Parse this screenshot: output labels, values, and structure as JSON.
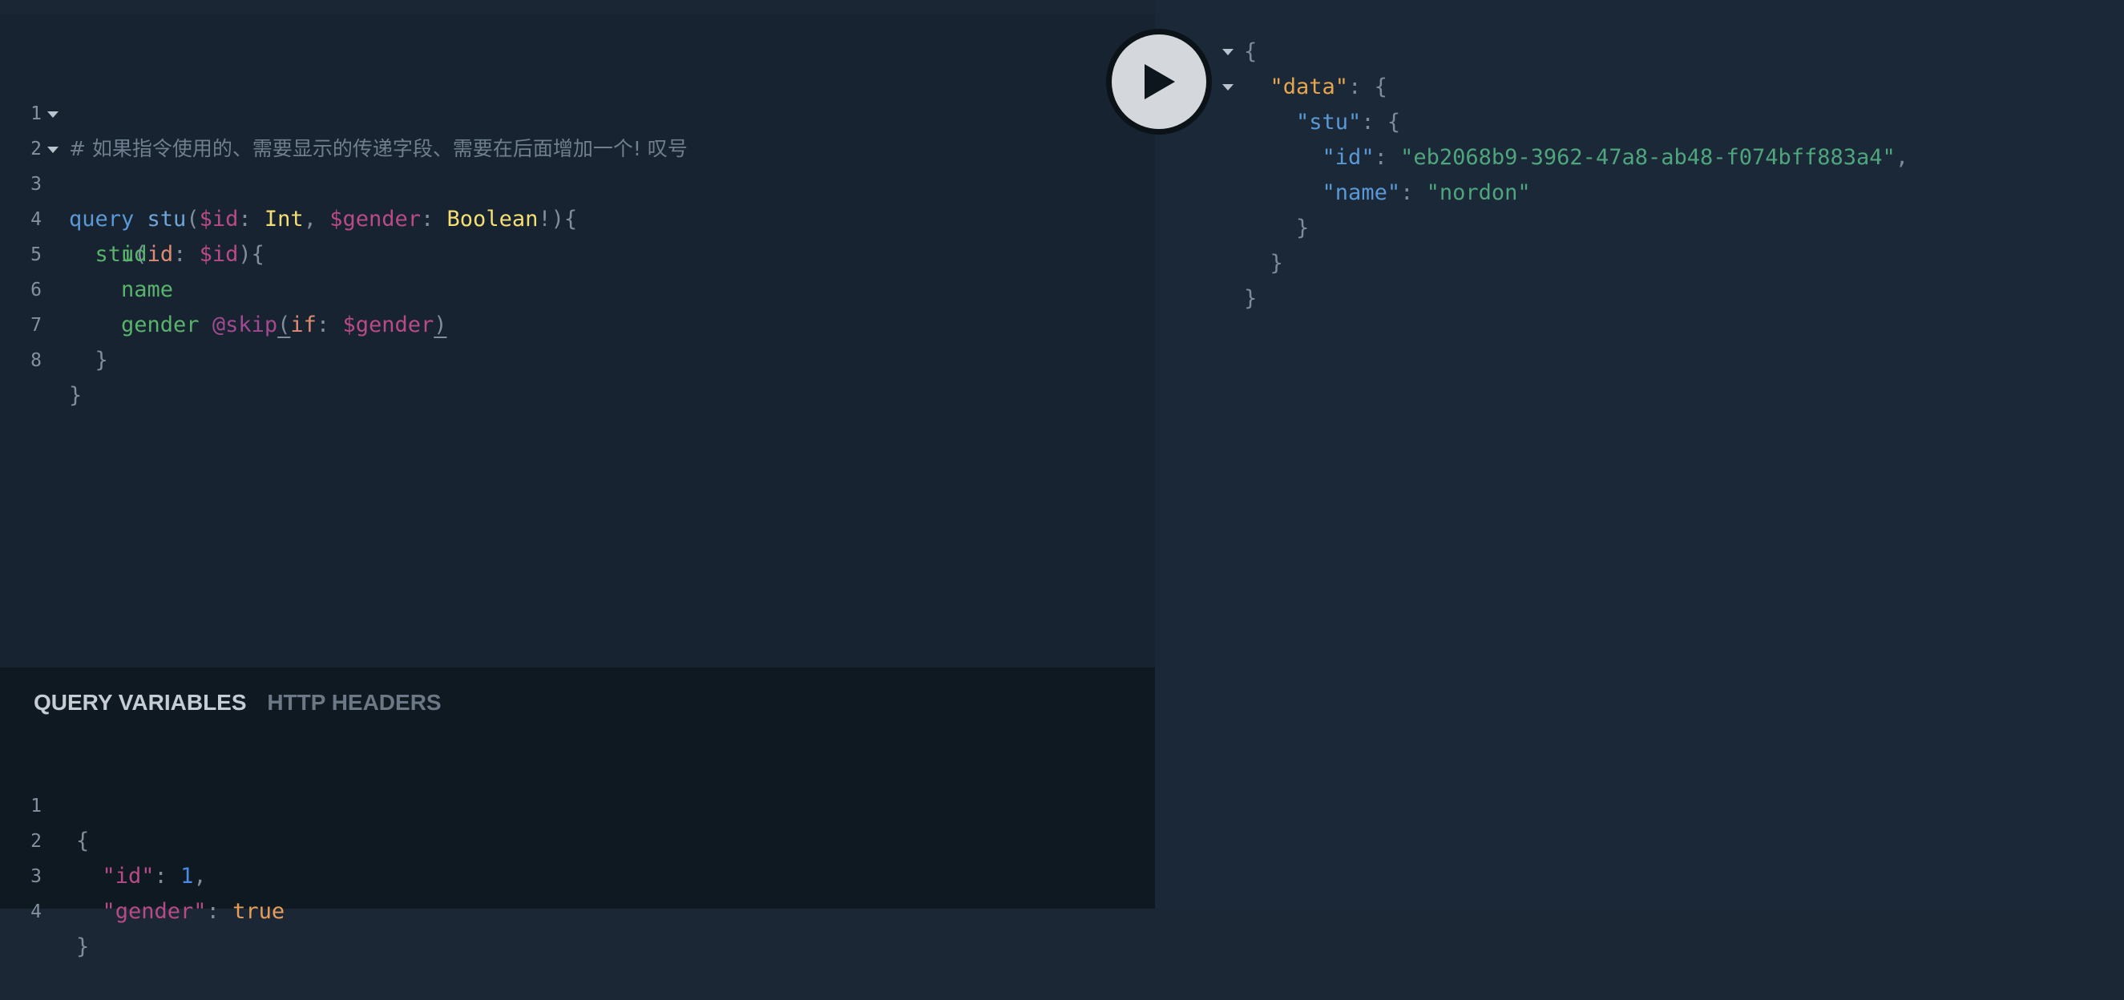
{
  "query_editor": {
    "line_numbers": [
      "1",
      "2",
      "3",
      "4",
      "5",
      "6",
      "7",
      "8"
    ],
    "comment": "# 如果指令使用的、需要显示的传递字段、需要在后面增加一个! 叹号",
    "tokens": {
      "query": "query",
      "op_name": "stu",
      "paren_open": "(",
      "var_id": "$id",
      "colon": ":",
      "int_type": "Int",
      "comma": ",",
      "var_gender": "$gender",
      "bool_type": "Boolean",
      "bang_paren_brace": "!){",
      "field_stu": "stu",
      "arg_id": "id",
      "paren_brace": "){",
      "field_id": "id",
      "field_name": "name",
      "field_gender": "gender",
      "directive_skip": "@skip",
      "arg_if": "if",
      "paren_close": ")",
      "close_brace": "}"
    }
  },
  "variables_panel": {
    "tabs": {
      "active": "QUERY VARIABLES",
      "inactive": "HTTP HEADERS"
    },
    "line_numbers": [
      "1",
      "2",
      "3",
      "4"
    ],
    "open_brace": "{",
    "close_brace": "}",
    "key_id": "\"id\"",
    "value_id": "1",
    "key_gender": "\"gender\"",
    "value_gender": "true",
    "colon": ":",
    "comma": ","
  },
  "execute_button": {
    "icon": "play-icon"
  },
  "result": {
    "open_brace": "{",
    "close_brace": "}",
    "key_data": "\"data\"",
    "key_stu": "\"stu\"",
    "key_id": "\"id\"",
    "value_id": "\"eb2068b9-3962-47a8-ab48-f074bff883a4\"",
    "key_name": "\"name\"",
    "value_name": "\"nordon\"",
    "colon": ":",
    "comma": ","
  }
}
